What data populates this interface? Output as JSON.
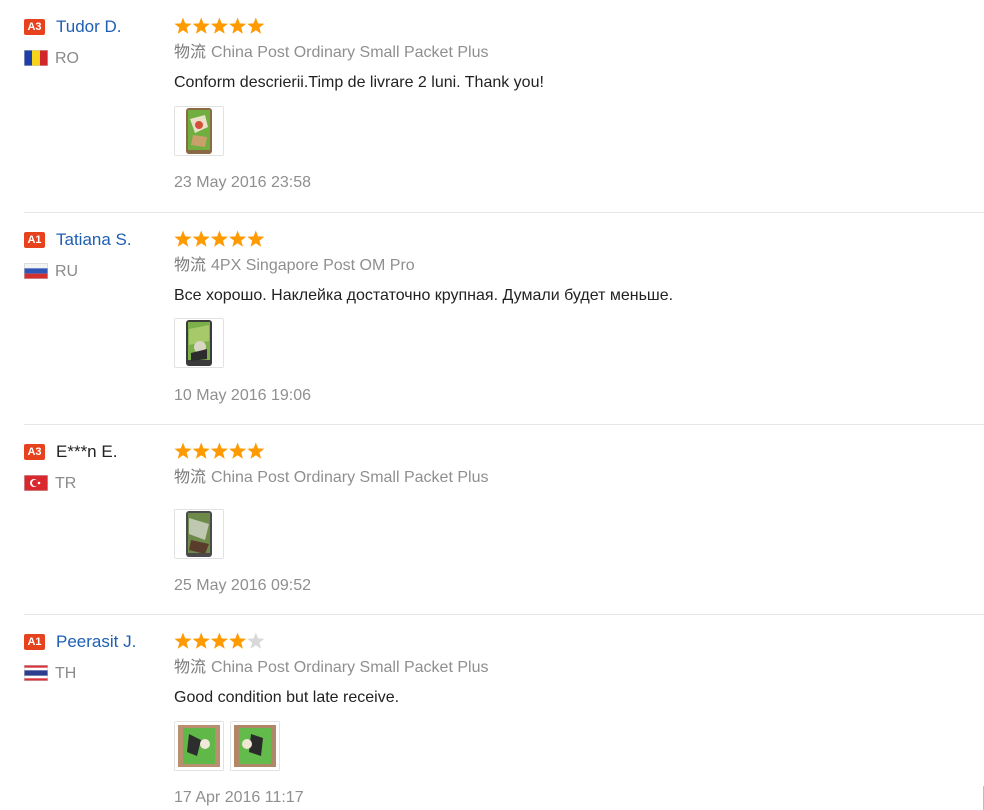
{
  "reviews": [
    {
      "level": "A3",
      "name": "Tudor D.",
      "country": "RO",
      "rating": 5,
      "logistics_label": "物流",
      "logistics": "China Post Ordinary Small Packet Plus",
      "text": "Conform descrierii.Timp de livrare 2 luni. Thank you!",
      "photos": 1,
      "date": "23 May 2016 23:58"
    },
    {
      "level": "A1",
      "name": "Tatiana S.",
      "country": "RU",
      "rating": 5,
      "logistics_label": "物流",
      "logistics": "4PX Singapore Post OM Pro",
      "text": "Все хорошо. Наклейка достаточно крупная. Думали будет меньше.",
      "photos": 1,
      "date": "10 May 2016 19:06"
    },
    {
      "level": "A3",
      "name": "E***n E.",
      "country": "TR",
      "rating": 5,
      "logistics_label": "物流",
      "logistics": "China Post Ordinary Small Packet Plus",
      "text": "",
      "photos": 1,
      "date": "25 May 2016 09:52"
    },
    {
      "level": "A1",
      "name": "Peerasit J.",
      "country": "TH",
      "rating": 4,
      "logistics_label": "物流",
      "logistics": "China Post Ordinary Small Packet Plus",
      "text": "Good condition but late receive.",
      "photos": 2,
      "date": "17 Apr 2016 11:17"
    }
  ],
  "colors": {
    "star_filled": "#ff9a00",
    "star_empty": "#d9d9d9",
    "badge": "#e6421e",
    "name_link": "#1e5fb4"
  }
}
